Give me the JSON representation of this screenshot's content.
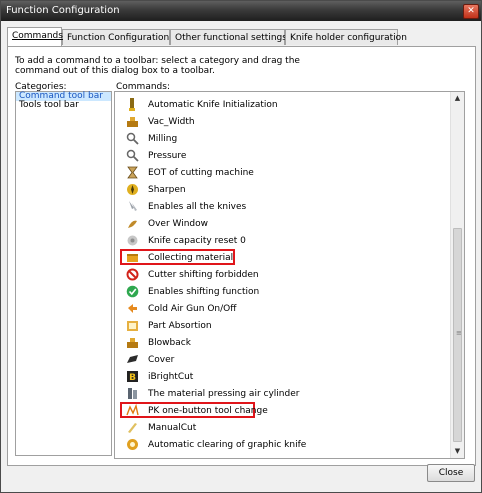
{
  "window": {
    "title": "Function Configuration",
    "close_glyph": "✕"
  },
  "tabs": [
    {
      "label": "Commands",
      "active": true
    },
    {
      "label": "Function Configuration",
      "active": false
    },
    {
      "label": "Other functional settings",
      "active": false
    },
    {
      "label": "Knife holder configuration",
      "active": false
    }
  ],
  "instructions": "To add a command to a toolbar: select a category and drag the command out of this dialog box to a toolbar.",
  "categories": {
    "label": "Categories:",
    "items": [
      {
        "label": "Command tool bar",
        "selected": true
      },
      {
        "label": "Tools tool bar",
        "selected": false
      }
    ]
  },
  "commands": {
    "label": "Commands:",
    "items": [
      {
        "label": "Automatic Knife Initialization",
        "icon": "knife-icon",
        "highlighted": false
      },
      {
        "label": "Vac_Width",
        "icon": "vacuum-icon",
        "highlighted": false
      },
      {
        "label": "Milling",
        "icon": "magnifier-icon",
        "highlighted": false
      },
      {
        "label": "Pressure",
        "icon": "magnifier-icon",
        "highlighted": false
      },
      {
        "label": "EOT of cutting machine",
        "icon": "hourglass-icon",
        "highlighted": false
      },
      {
        "label": "Sharpen",
        "icon": "sharpen-icon",
        "highlighted": false
      },
      {
        "label": "Enables all the knives",
        "icon": "knives-icon",
        "highlighted": false
      },
      {
        "label": "Over Window",
        "icon": "over-window-icon",
        "highlighted": false
      },
      {
        "label": "Knife capacity reset 0",
        "icon": "reset-icon",
        "highlighted": false
      },
      {
        "label": "Collecting material",
        "icon": "collect-icon",
        "highlighted": true
      },
      {
        "label": "Cutter shifting forbidden",
        "icon": "forbidden-icon",
        "highlighted": false
      },
      {
        "label": "Enables shifting function",
        "icon": "check-icon",
        "highlighted": false
      },
      {
        "label": "Cold Air Gun On/Off",
        "icon": "air-gun-icon",
        "highlighted": false
      },
      {
        "label": "Part Absortion",
        "icon": "absorption-icon",
        "highlighted": false
      },
      {
        "label": "Blowback",
        "icon": "blowback-icon",
        "highlighted": false
      },
      {
        "label": "Cover",
        "icon": "cover-icon",
        "highlighted": false
      },
      {
        "label": "iBrightCut",
        "icon": "ibrightcut-icon",
        "highlighted": false
      },
      {
        "label": "The material pressing air cylinder",
        "icon": "press-cylinder-icon",
        "highlighted": false
      },
      {
        "label": "PK one-button tool change",
        "icon": "tool-change-icon",
        "highlighted": true
      },
      {
        "label": "ManualCut",
        "icon": "manual-cut-icon",
        "highlighted": false
      },
      {
        "label": "Automatic clearing of graphic knife",
        "icon": "auto-clear-icon",
        "highlighted": false
      }
    ]
  },
  "scrollbar": {
    "up_glyph": "▲",
    "down_glyph": "▼",
    "grip_glyph": "≡"
  },
  "buttons": {
    "close_label": "Close"
  },
  "colors": {
    "highlight_box": "#e0151a",
    "selection": "#cce8ff"
  }
}
